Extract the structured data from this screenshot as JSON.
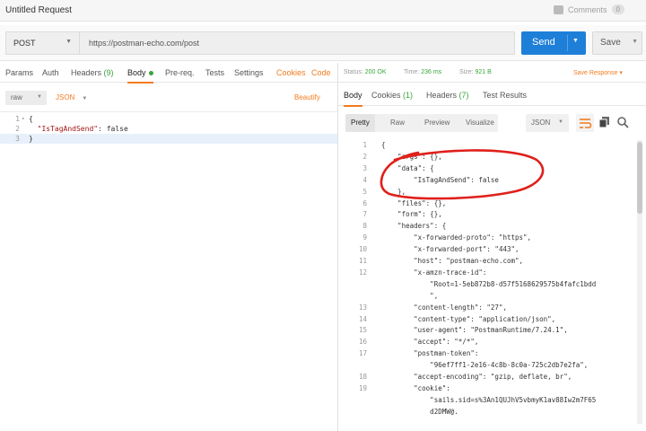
{
  "window": {
    "title": "Untitled Request",
    "comments_label": "Comments",
    "comments_count": "0"
  },
  "request": {
    "method": "POST",
    "url": "https://postman-echo.com/post",
    "send_label": "Send",
    "save_label": "Save"
  },
  "request_tabs": [
    {
      "label": "Params"
    },
    {
      "label": "Auth"
    },
    {
      "label": "Headers",
      "count": "(9)"
    },
    {
      "label": "Body"
    },
    {
      "label": "Pre-req."
    },
    {
      "label": "Tests"
    },
    {
      "label": "Settings"
    },
    {
      "label": "Cookies"
    },
    {
      "label": "Code"
    }
  ],
  "body_bar": {
    "mode": "raw",
    "format": "JSON",
    "beautify": "Beautify"
  },
  "request_body": {
    "line1": "{",
    "line2_key": "\"IsTagAndSend\"",
    "line2_rest": ": false",
    "line3": "}"
  },
  "status": {
    "status_label": "Status:",
    "status_value": "200 OK",
    "time_label": "Time:",
    "time_value": "236 ms",
    "size_label": "Size:",
    "size_value": "921 B",
    "save_response": "Save Response"
  },
  "response_tabs": [
    {
      "label": "Body"
    },
    {
      "label": "Cookies",
      "count": "(1)"
    },
    {
      "label": "Headers",
      "count": "(7)"
    },
    {
      "label": "Test Results"
    }
  ],
  "view": {
    "modes": [
      "Pretty",
      "Raw",
      "Preview",
      "Visualize"
    ],
    "format": "JSON"
  },
  "response_lines": [
    {
      "n": "1",
      "t": "{"
    },
    {
      "n": "2",
      "t": "    \"args\": {},"
    },
    {
      "n": "3",
      "t": "    \"data\": {"
    },
    {
      "n": "4",
      "t": "        \"IsTagAndSend\": false"
    },
    {
      "n": "5",
      "t": "    },"
    },
    {
      "n": "6",
      "t": "    \"files\": {},"
    },
    {
      "n": "7",
      "t": "    \"form\": {},"
    },
    {
      "n": "8",
      "t": "    \"headers\": {"
    },
    {
      "n": "9",
      "t": "        \"x-forwarded-proto\": \"https\","
    },
    {
      "n": "10",
      "t": "        \"x-forwarded-port\": \"443\","
    },
    {
      "n": "11",
      "t": "        \"host\": \"postman-echo.com\","
    },
    {
      "n": "12",
      "t": "        \"x-amzn-trace-id\":"
    },
    {
      "n": "",
      "t": "            \"Root=1-5eb872b8-d57f5168629575b4fafc1bdd"
    },
    {
      "n": "",
      "t": "            \","
    },
    {
      "n": "13",
      "t": "        \"content-length\": \"27\","
    },
    {
      "n": "14",
      "t": "        \"content-type\": \"application/json\","
    },
    {
      "n": "15",
      "t": "        \"user-agent\": \"PostmanRuntime/7.24.1\","
    },
    {
      "n": "16",
      "t": "        \"accept\": \"*/*\","
    },
    {
      "n": "17",
      "t": "        \"postman-token\":"
    },
    {
      "n": "",
      "t": "            \"96ef7ff1-2e16-4c8b-8c0a-725c2db7e2fa\","
    },
    {
      "n": "18",
      "t": "        \"accept-encoding\": \"gzip, deflate, br\","
    },
    {
      "n": "19",
      "t": "        \"cookie\":"
    },
    {
      "n": "",
      "t": "            \"sails.sid=s%3An1QUJhV5vbmyK1av88Iw2m7F65"
    },
    {
      "n": "",
      "t": "            d2DMW@."
    }
  ],
  "colors": {
    "accent": "#f27b1f",
    "send": "#1e7fd8",
    "success": "#39a53a",
    "annotation": "#e0201b"
  }
}
